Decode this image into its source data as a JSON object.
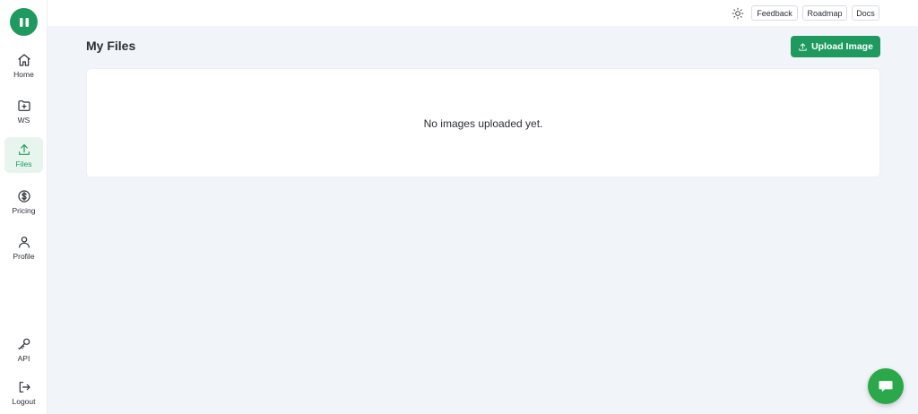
{
  "sidebar": {
    "logo_icon": "logo-icon",
    "items": [
      {
        "label": "Home",
        "icon": "home-icon"
      },
      {
        "label": "WS",
        "icon": "folder-plus-icon"
      },
      {
        "label": "Files",
        "icon": "upload-icon",
        "active": true
      },
      {
        "label": "Pricing",
        "icon": "dollar-icon"
      },
      {
        "label": "Profile",
        "icon": "user-icon"
      }
    ],
    "bottom_items": [
      {
        "label": "API",
        "icon": "key-icon"
      },
      {
        "label": "Logout",
        "icon": "logout-icon"
      }
    ]
  },
  "topbar": {
    "theme_icon": "sun-icon",
    "feedback_label": "Feedback",
    "roadmap_label": "Roadmap",
    "docs_label": "Docs"
  },
  "main": {
    "title": "My Files",
    "upload_label": "Upload Image",
    "empty_message": "No images uploaded yet."
  },
  "chat": {
    "icon": "chat-icon"
  },
  "colors": {
    "accent": "#1e9a5e",
    "chat": "#2aa84a",
    "background": "#f1f4f8"
  }
}
